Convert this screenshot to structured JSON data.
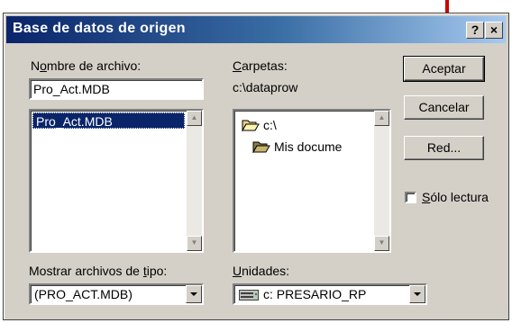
{
  "window": {
    "title": "Base de datos de origen",
    "help_glyph": "?",
    "close_glyph": "×"
  },
  "file": {
    "label_pre": "N",
    "label_u": "o",
    "label_post": "mbre de archivo:",
    "value": "Pro_Act.MDB",
    "list": [
      "Pro_Act.MDB"
    ]
  },
  "folders": {
    "label_u": "C",
    "label_post": "arpetas:",
    "path": "c:\\dataprow",
    "tree": [
      {
        "name": "c:\\",
        "icon": "open-folder-icon"
      },
      {
        "name": "Mis docume",
        "icon": "folder-icon"
      }
    ]
  },
  "buttons": {
    "accept": "Aceptar",
    "cancel": "Cancelar",
    "network": "Red..."
  },
  "readonly": {
    "label_u": "S",
    "label_post": "ólo lectura",
    "checked": false
  },
  "filetype": {
    "label_pre": "Mostrar archivos de ",
    "label_u": "t",
    "label_post": "ipo:",
    "value": "(PRO_ACT.MDB)"
  },
  "drives": {
    "label_u": "U",
    "label_post": "nidades:",
    "value": "c: PRESARIO_RP"
  },
  "colors": {
    "title_start": "#0a246a",
    "title_end": "#a6caf0",
    "annotation_arrow": "#cc0000"
  }
}
